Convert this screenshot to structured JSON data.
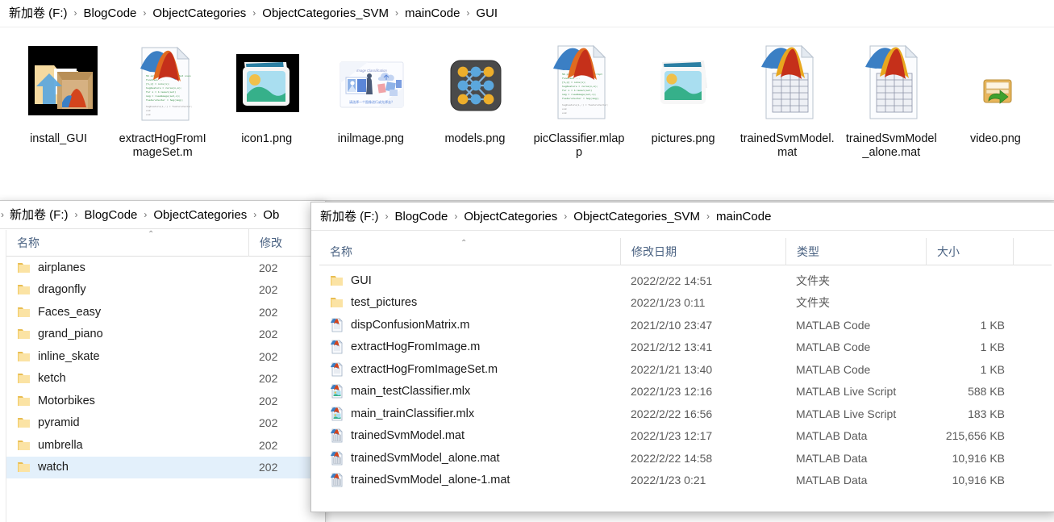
{
  "top_window": {
    "breadcrumb": [
      "新加卷 (F:)",
      "BlogCode",
      "ObjectCategories",
      "ObjectCategories_SVM",
      "mainCode",
      "GUI"
    ],
    "separator": "›",
    "items": [
      {
        "label": "install_GUI",
        "icon": "folder-upload-matlab-icon"
      },
      {
        "label": "extractHogFromImageSet.m",
        "icon": "matlab-code-file-icon"
      },
      {
        "label": "icon1.png",
        "icon": "picture-stack-dark-icon"
      },
      {
        "label": "inilmage.png",
        "icon": "illustration-image-icon"
      },
      {
        "label": "models.png",
        "icon": "neural-network-dark-icon"
      },
      {
        "label": "picClassifier.mlapp",
        "icon": "matlab-app-file-icon"
      },
      {
        "label": "pictures.png",
        "icon": "picture-stack-light-icon"
      },
      {
        "label": "trainedSvmModel.mat",
        "icon": "matlab-data-file-icon"
      },
      {
        "label": "trainedSvmModel_alone.mat",
        "icon": "matlab-data-file-icon"
      },
      {
        "label": "video.png",
        "icon": "video-folder-icon"
      }
    ]
  },
  "left_window": {
    "breadcrumb": [
      "新加卷 (F:)",
      "BlogCode",
      "ObjectCategories",
      "Ob"
    ],
    "separator": "›",
    "columns": {
      "name": "名称",
      "modified": "修改"
    },
    "sort_caret": "⌃",
    "rows": [
      {
        "name": "airplanes",
        "modified": "202",
        "icon": "folder-icon",
        "selected": false
      },
      {
        "name": "dragonfly",
        "modified": "202",
        "icon": "folder-icon",
        "selected": false
      },
      {
        "name": "Faces_easy",
        "modified": "202",
        "icon": "folder-icon",
        "selected": false
      },
      {
        "name": "grand_piano",
        "modified": "202",
        "icon": "folder-icon",
        "selected": false
      },
      {
        "name": "inline_skate",
        "modified": "202",
        "icon": "folder-icon",
        "selected": false
      },
      {
        "name": "ketch",
        "modified": "202",
        "icon": "folder-icon",
        "selected": false
      },
      {
        "name": "Motorbikes",
        "modified": "202",
        "icon": "folder-icon",
        "selected": false
      },
      {
        "name": "pyramid",
        "modified": "202",
        "icon": "folder-icon",
        "selected": false
      },
      {
        "name": "umbrella",
        "modified": "202",
        "icon": "folder-icon",
        "selected": false
      },
      {
        "name": "watch",
        "modified": "202",
        "icon": "folder-icon",
        "selected": true
      }
    ]
  },
  "main_window": {
    "breadcrumb": [
      "新加卷 (F:)",
      "BlogCode",
      "ObjectCategories",
      "ObjectCategories_SVM",
      "mainCode"
    ],
    "separator": "›",
    "columns": {
      "name": "名称",
      "modified": "修改日期",
      "type": "类型",
      "size": "大小"
    },
    "sort_caret": "⌃",
    "rows": [
      {
        "name": "GUI",
        "modified": "2022/2/22 14:51",
        "type": "文件夹",
        "size": "",
        "icon": "folder-icon"
      },
      {
        "name": "test_pictures",
        "modified": "2022/1/23 0:11",
        "type": "文件夹",
        "size": "",
        "icon": "folder-icon"
      },
      {
        "name": "dispConfusionMatrix.m",
        "modified": "2021/2/10 23:47",
        "type": "MATLAB Code",
        "size": "1 KB",
        "icon": "matlab-code-icon"
      },
      {
        "name": "extractHogFromImage.m",
        "modified": "2021/2/12 13:41",
        "type": "MATLAB Code",
        "size": "1 KB",
        "icon": "matlab-code-icon"
      },
      {
        "name": "extractHogFromImageSet.m",
        "modified": "2022/1/21 13:40",
        "type": "MATLAB Code",
        "size": "1 KB",
        "icon": "matlab-code-icon"
      },
      {
        "name": "main_testClassifier.mlx",
        "modified": "2022/1/23 12:16",
        "type": "MATLAB Live Script",
        "size": "588 KB",
        "icon": "matlab-live-icon"
      },
      {
        "name": "main_trainClassifier.mlx",
        "modified": "2022/2/22 16:56",
        "type": "MATLAB Live Script",
        "size": "183 KB",
        "icon": "matlab-live-icon"
      },
      {
        "name": "trainedSvmModel.mat",
        "modified": "2022/1/23 12:17",
        "type": "MATLAB Data",
        "size": "215,656 KB",
        "icon": "matlab-data-icon"
      },
      {
        "name": "trainedSvmModel_alone.mat",
        "modified": "2022/2/22 14:58",
        "type": "MATLAB Data",
        "size": "10,916 KB",
        "icon": "matlab-data-icon"
      },
      {
        "name": "trainedSvmModel_alone-1.mat",
        "modified": "2022/1/23 0:21",
        "type": "MATLAB Data",
        "size": "10,916 KB",
        "icon": "matlab-data-icon"
      }
    ]
  },
  "colors": {
    "folder": "#ffd77a",
    "selection": "#e3f0fb",
    "header_text": "#4a6282",
    "secondary_text": "#5a5a5a",
    "matlab_orange": "#d4441c",
    "matlab_blue": "#3b7fc4"
  }
}
